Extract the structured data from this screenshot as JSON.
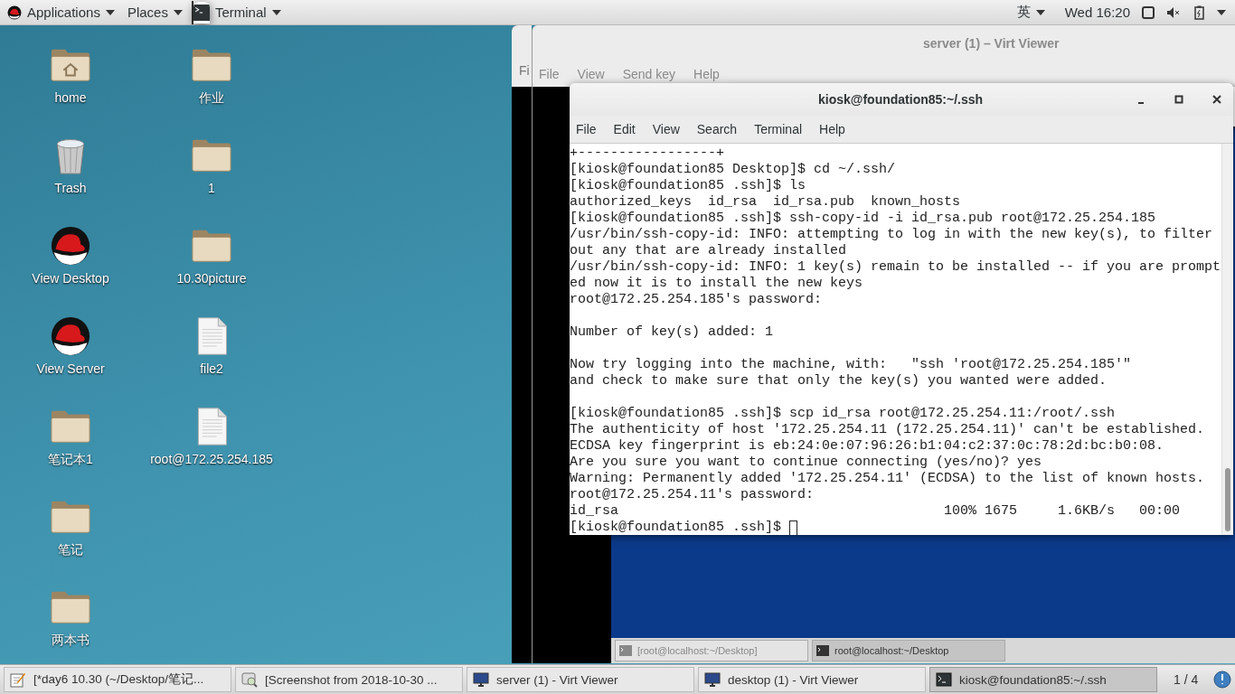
{
  "top_bar": {
    "menus": [
      {
        "label": "Applications",
        "kind": "logo"
      },
      {
        "label": "Places",
        "kind": "plain"
      },
      {
        "label": "Terminal",
        "kind": "app"
      }
    ],
    "input_method": "英",
    "clock": "Wed 16:20"
  },
  "desktop_icons": {
    "column_1": [
      {
        "label": "home",
        "kind": "home"
      },
      {
        "label": "Trash",
        "kind": "trash"
      },
      {
        "label": "View Desktop",
        "kind": "launcher"
      },
      {
        "label": "View Server",
        "kind": "launcher"
      },
      {
        "label": "笔记本1",
        "kind": "folder"
      },
      {
        "label": "笔记",
        "kind": "folder"
      },
      {
        "label": "两本书",
        "kind": "folder"
      }
    ],
    "column_2": [
      {
        "label": "作业",
        "kind": "folder"
      },
      {
        "label": "1",
        "kind": "folder"
      },
      {
        "label": "10.30picture",
        "kind": "folder"
      },
      {
        "label": "file2",
        "kind": "file"
      },
      {
        "label": "root@172.25.254.185",
        "kind": "file"
      }
    ]
  },
  "back_viewer": {
    "menu": [
      "Fi"
    ]
  },
  "virt_viewer": {
    "title": "server (1) – Virt Viewer",
    "menu": [
      "File",
      "View",
      "Send key",
      "Help"
    ],
    "guest_taskbar": [
      {
        "label": "[root@localhost:~/Desktop]",
        "selected": false
      },
      {
        "label": "root@localhost:~/Desktop",
        "selected": true
      }
    ]
  },
  "terminal": {
    "title": "kiosk@foundation85:~/.ssh",
    "menu": [
      "File",
      "Edit",
      "View",
      "Search",
      "Terminal",
      "Help"
    ],
    "blocks": [
      [
        "+-----------------+",
        "[kiosk@foundation85 Desktop]$ cd ~/.ssh/",
        "[kiosk@foundation85 .ssh]$ ls",
        "authorized_keys  id_rsa  id_rsa.pub  known_hosts",
        "[kiosk@foundation85 .ssh]$ ssh-copy-id -i id_rsa.pub root@172.25.254.185",
        "/usr/bin/ssh-copy-id: INFO: attempting to log in with the new key(s), to filter",
        "out any that are already installed",
        "/usr/bin/ssh-copy-id: INFO: 1 key(s) remain to be installed -- if you are prompt",
        "ed now it is to install the new keys",
        "root@172.25.254.185's password:"
      ],
      [
        "Number of key(s) added: 1"
      ],
      [
        "Now try logging into the machine, with:   \"ssh 'root@172.25.254.185'\"",
        "and check to make sure that only the key(s) you wanted were added."
      ],
      [
        "[kiosk@foundation85 .ssh]$ scp id_rsa root@172.25.254.11:/root/.ssh",
        "The authenticity of host '172.25.254.11 (172.25.254.11)' can't be established.",
        "ECDSA key fingerprint is eb:24:0e:07:96:26:b1:04:c2:37:0c:78:2d:bc:b0:08.",
        "Are you sure you want to continue connecting (yes/no)? yes",
        "Warning: Permanently added '172.25.254.11' (ECDSA) to the list of known hosts.",
        "root@172.25.254.11's password:",
        "id_rsa                                        100% 1675     1.6KB/s   00:00",
        "[kiosk@foundation85 .ssh]$ "
      ]
    ]
  },
  "taskbar": {
    "items": [
      {
        "label": "[*day6 10.30 (~/Desktop/笔记...",
        "kind": "editor",
        "selected": false
      },
      {
        "label": "[Screenshot from 2018-10-30 ...",
        "kind": "viewer",
        "selected": false
      },
      {
        "label": "server (1) - Virt Viewer",
        "kind": "monitor",
        "selected": false
      },
      {
        "label": "desktop (1) - Virt Viewer",
        "kind": "monitor",
        "selected": false
      },
      {
        "label": "kiosk@foundation85:~/.ssh",
        "kind": "terminal",
        "selected": true
      }
    ],
    "pager": "1 / 4"
  }
}
